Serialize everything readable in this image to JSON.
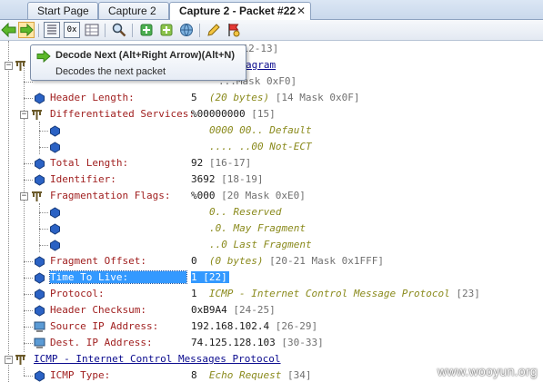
{
  "tabs": [
    {
      "label": "Start Page"
    },
    {
      "label": "Capture 2"
    },
    {
      "label": "Capture 2 - Packet #22",
      "close": "✕"
    }
  ],
  "tooltip": {
    "title": "Decode Next (Alt+Right Arrow)(Alt+N)",
    "body": "Decodes the next packet"
  },
  "toolbar": {
    "hex_label": "0x"
  },
  "tree": {
    "partial_top": "IP [12-13]",
    "ip_header_partial": "agram",
    "version_partial": "...Mask 0xF0]",
    "header_length": {
      "label": "Header Length:",
      "value": "5",
      "desc": "(20 bytes)",
      "off": "[14 Mask 0x0F]"
    },
    "diff_services": {
      "label": "Differentiated Services:",
      "value": "%00000000",
      "off": "[15]"
    },
    "diff_bit1": "0000 00.. Default",
    "diff_bit2": ".... ..00 Not-ECT",
    "total_length": {
      "label": "Total Length:",
      "value": "92",
      "off": "[16-17]"
    },
    "identifier": {
      "label": "Identifier:",
      "value": "3692",
      "off": "[18-19]"
    },
    "frag_flags": {
      "label": "Fragmentation Flags:",
      "value": "%000",
      "off": "[20 Mask 0xE0]"
    },
    "frag_bit1": "0.. Reserved",
    "frag_bit2": ".0. May Fragment",
    "frag_bit3": "..0 Last Fragment",
    "frag_offset": {
      "label": "Fragment Offset:",
      "value": "0",
      "desc": "(0 bytes)",
      "off": "[20-21 Mask 0x1FFF]"
    },
    "ttl": {
      "label": "Time To Live:",
      "value": "1",
      "off": "[22]"
    },
    "protocol": {
      "label": "Protocol:",
      "value": "1",
      "desc": "ICMP - Internet Control Message Protocol",
      "off": "[23]"
    },
    "checksum": {
      "label": "Header Checksum:",
      "value": "0xB9A4",
      "off": "[24-25]"
    },
    "src_ip": {
      "label": "Source IP Address:",
      "value": "192.168.102.4",
      "off": "[26-29]"
    },
    "dst_ip": {
      "label": "Dest. IP Address:",
      "value": "74.125.128.103",
      "off": "[30-33]"
    },
    "icmp_header": "ICMP - Internet Control Messages Protocol",
    "icmp_type": {
      "label": "ICMP Type:",
      "value": "8",
      "desc": "Echo Request",
      "off": "[34]"
    }
  },
  "watermark": "www.wooyun.org",
  "colors": {
    "field_label": "#a01f1f",
    "header_label": "#0b0b8e",
    "selection": "#3399ff",
    "desc": "#8a8a1c"
  }
}
